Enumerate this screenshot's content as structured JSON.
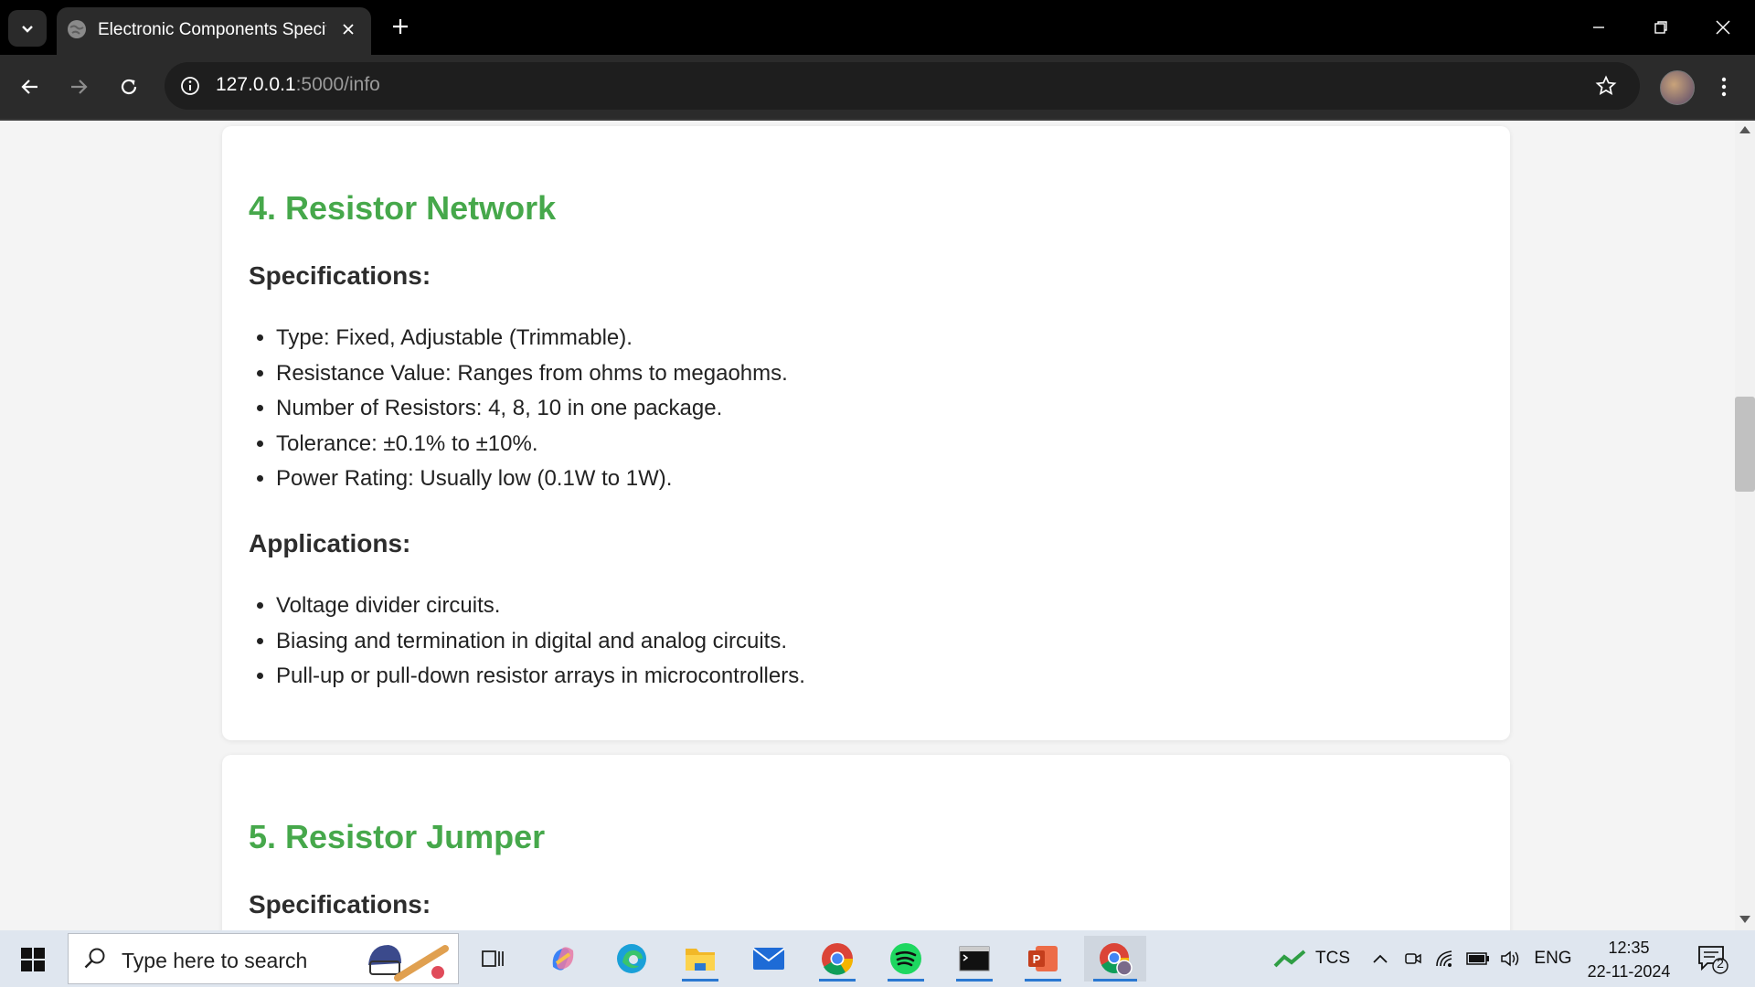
{
  "browser": {
    "tab_title": "Electronic Components Specific",
    "url_host": "127.0.0.1",
    "url_path": ":5000/info"
  },
  "sections": [
    {
      "title": "4. Resistor Network",
      "specs_heading": "Specifications:",
      "specs": [
        "Type: Fixed, Adjustable (Trimmable).",
        "Resistance Value: Ranges from ohms to megaohms.",
        "Number of Resistors: 4, 8, 10 in one package.",
        "Tolerance: ±0.1% to ±10%.",
        "Power Rating: Usually low (0.1W to 1W)."
      ],
      "apps_heading": "Applications:",
      "applications": [
        "Voltage divider circuits.",
        "Biasing and termination in digital and analog circuits.",
        "Pull-up or pull-down resistor arrays in microcontrollers."
      ]
    },
    {
      "title": "5. Resistor Jumper",
      "specs_heading": "Specifications:"
    }
  ],
  "taskbar": {
    "search_placeholder": "Type here to search",
    "stock_label": "TCS",
    "language": "ENG",
    "time": "12:35",
    "date": "22-11-2024",
    "notification_count": "2"
  },
  "colors": {
    "heading_green": "#46a84b",
    "tab_bar": "#000000",
    "toolbar": "#2b2b2b"
  }
}
